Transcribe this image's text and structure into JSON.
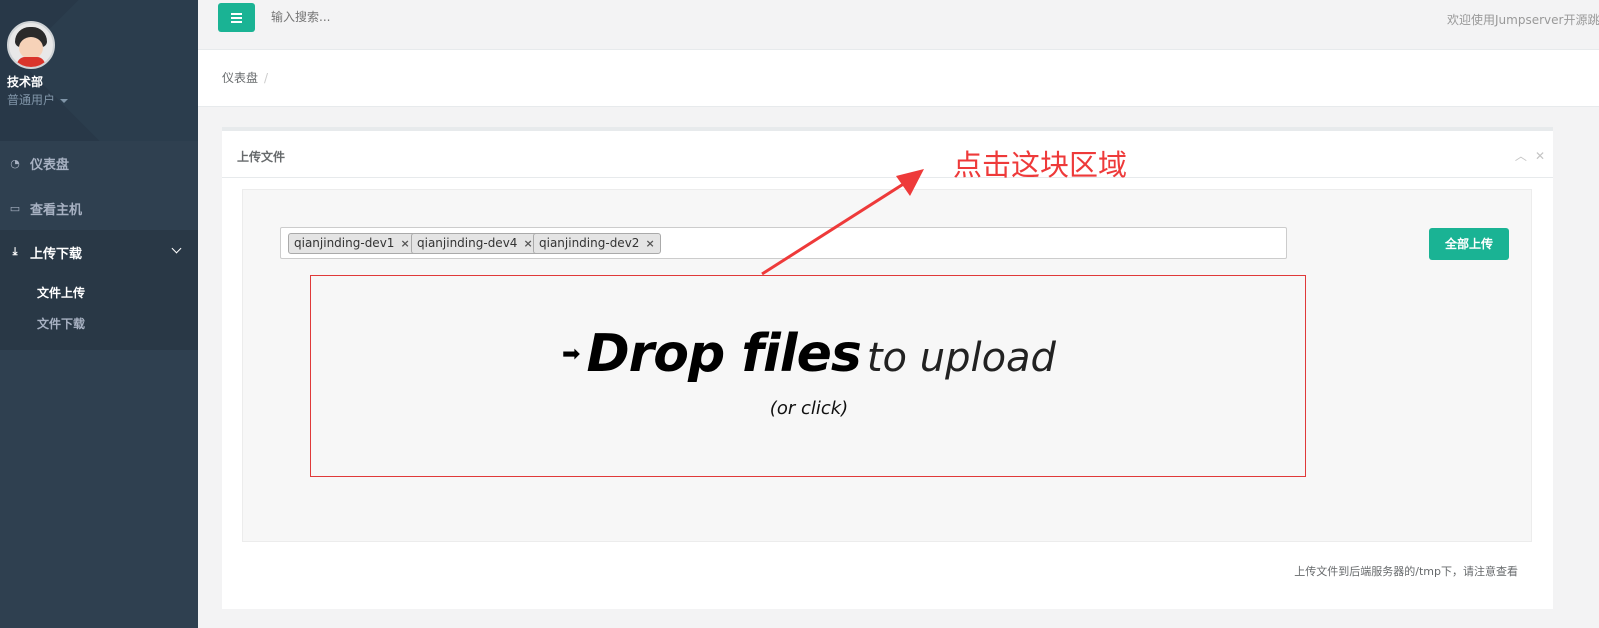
{
  "sidebar": {
    "user": {
      "department": "技术部",
      "role": "普通用户"
    },
    "nav": [
      {
        "label": "仪表盘",
        "icon": "dashboard-icon"
      },
      {
        "label": "查看主机",
        "icon": "server-icon"
      },
      {
        "label": "上传下载",
        "icon": "download-icon"
      }
    ],
    "submenu": [
      {
        "label": "文件上传",
        "active": true
      },
      {
        "label": "文件下载",
        "active": false
      }
    ]
  },
  "topbar": {
    "search_placeholder": "输入搜索...",
    "welcome": "欢迎使用Jumpserver开源跳板机"
  },
  "breadcrumb": {
    "home": "仪表盘",
    "separator": "/"
  },
  "panel": {
    "title": "上传文件",
    "tags": [
      "qianjinding-dev1",
      "qianjinding-dev4",
      "qianjinding-dev2"
    ],
    "remove_glyph": "×",
    "upload_all_label": "全部上传",
    "dropzone": {
      "bold": "Drop files",
      "light": "to upload",
      "sub": "(or click)"
    },
    "footnote": "上传文件到后端服务器的/tmp下，请注意查看"
  },
  "annotation": {
    "text": "点击这块区域",
    "color": "#ee3a3a"
  },
  "colors": {
    "accent": "#1ab394",
    "sidebar": "#2f4050"
  }
}
